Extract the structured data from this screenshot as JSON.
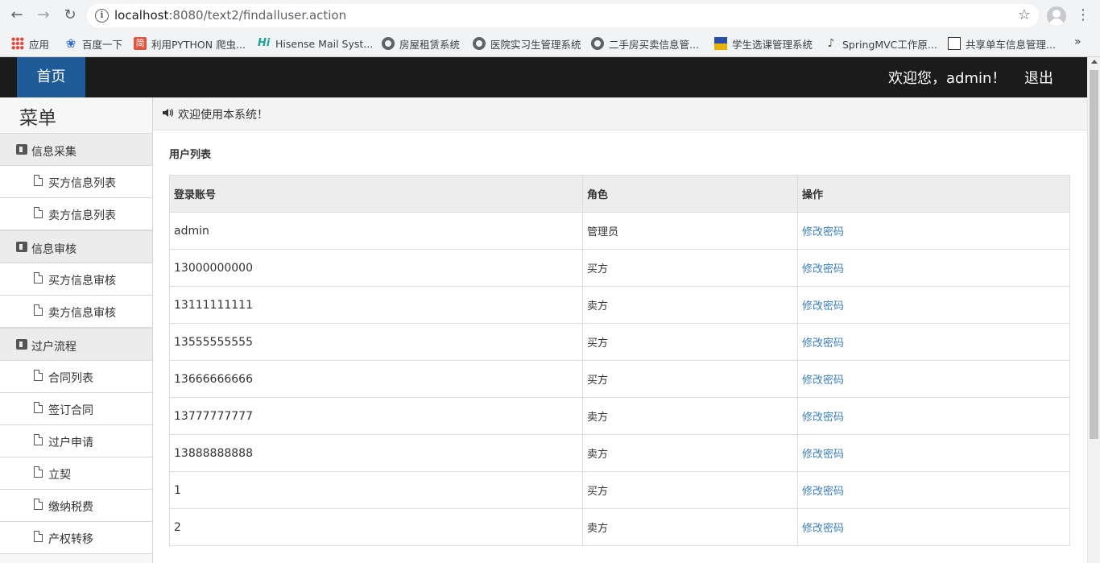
{
  "browser": {
    "url_host": "localhost",
    "url_rest": ":8080/text2/findalluser.action",
    "bookmarks": [
      {
        "label": "应用",
        "icon": "apps-grid-icon"
      },
      {
        "label": "百度一下",
        "icon": "baidu-paw-icon"
      },
      {
        "label": "利用PYTHON 爬虫...",
        "icon": "jian-icon",
        "icon_text": "简"
      },
      {
        "label": "Hisense Mail Syst...",
        "icon": "hisense-icon",
        "icon_text": "Hi"
      },
      {
        "label": "房屋租赁系统",
        "icon": "globe-icon"
      },
      {
        "label": "医院实习生管理系统",
        "icon": "globe-icon"
      },
      {
        "label": "二手房买卖信息管...",
        "icon": "globe-icon"
      },
      {
        "label": "学生选课管理系统",
        "icon": "flag-icon"
      },
      {
        "label": "SpringMVC工作原...",
        "icon": "leaf-icon"
      },
      {
        "label": "共享单车信息管理...",
        "icon": "bike-icon"
      }
    ],
    "more": "»"
  },
  "header": {
    "home": "首页",
    "welcome": "欢迎您，admin！",
    "logout": "退出"
  },
  "sidebar": {
    "title": "菜单",
    "groups": [
      {
        "label": "信息采集",
        "items": [
          "买方信息列表",
          "卖方信息列表"
        ]
      },
      {
        "label": "信息审核",
        "items": [
          "买方信息审核",
          "卖方信息审核"
        ]
      },
      {
        "label": "过户流程",
        "items": [
          "合同列表",
          "签订合同",
          "过户申请",
          "立契",
          "缴纳税费",
          "产权转移"
        ]
      }
    ]
  },
  "main": {
    "notice": "欢迎使用本系统！",
    "section_title": "用户列表",
    "table": {
      "headers": [
        "登录账号",
        "角色",
        "操作"
      ],
      "rows": [
        {
          "account": "admin",
          "role": "管理员",
          "action": "修改密码"
        },
        {
          "account": "13000000000",
          "role": "买方",
          "action": "修改密码"
        },
        {
          "account": "13111111111",
          "role": "卖方",
          "action": "修改密码"
        },
        {
          "account": "13555555555",
          "role": "买方",
          "action": "修改密码"
        },
        {
          "account": "13666666666",
          "role": "买方",
          "action": "修改密码"
        },
        {
          "account": "13777777777",
          "role": "卖方",
          "action": "修改密码"
        },
        {
          "account": "13888888888",
          "role": "卖方",
          "action": "修改密码"
        },
        {
          "account": "1",
          "role": "买方",
          "action": "修改密码"
        },
        {
          "account": "2",
          "role": "卖方",
          "action": "修改密码"
        }
      ]
    }
  }
}
